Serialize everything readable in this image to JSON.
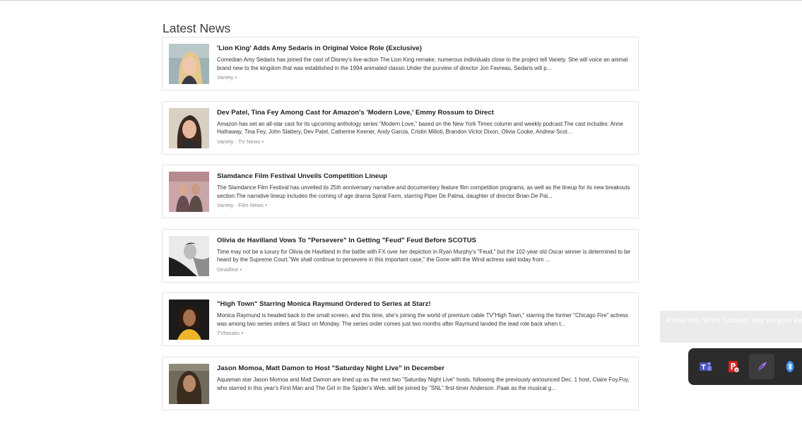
{
  "page": {
    "title": "Latest News"
  },
  "articles": [
    {
      "headline": "'Lion King' Adds Amy Sedaris in Original Voice Role (Exclusive)",
      "summary": "Comedian Amy Sedaris has joined the cast of Disney's live-action The Lion King remake, numerous individuals close to the project tell Variety. She will voice an animal brand new to the kingdom that was established in the 1994 animated classic.Under the purview of director Jon Favreau, Sedaris will p...",
      "source": "Variety •"
    },
    {
      "headline": "Dev Patel, Tina Fey Among Cast for Amazon's 'Modern Love,' Emmy Rossum to Direct",
      "summary": "Amazon has set an all-star cast for its upcoming anthology series “Modern Love,” based on the New York Times column and weekly podcast.The cast includes: Anne Hathaway, Tina Fey, John Slattery, Dev Patel, Catherine Keener, Andy Garcia, Cristin Milioti, Brandon Victor Dixon, Olivia Cooke, Andrew Scot...",
      "source": "Variety · TV News •"
    },
    {
      "headline": "Slamdance Film Festival Unveils Competition Lineup",
      "summary": "The Slamdance Film Festival has unveiled its 25th anniversary narrative and documentary feature film competition programs, as well as the lineup for its new breakouts section.The narrative lineup includes the coming of age drama Spiral Farm, starring Piper De Palma, daughter of director Brian De Pal...",
      "source": "Variety · Film News •"
    },
    {
      "headline": "Olivia de Havilland Vows To \"Persevere\" In Getting \"Feud\" Feud Before SCOTUS",
      "summary": "Time may not be a luxury for Olivia de Havilland in the battle with FX over her depiction in Ryan Murphy's \"Feud,\" but the 102-year old Oscar winner is determined to be heard by the Supreme Court.\"We shall continue to persevere in this important case,\" the Gone with the Wind actress said today from ...",
      "source": "Deadline •"
    },
    {
      "headline": "\"High Town\" Starring Monica Raymund Ordered to Series at Starz!",
      "summary": "Monica Raymund is headed back to the small screen, and this time, she's joining the world of premium cable TV\"High Town,\" starring the former \"Chicago Fire\" actress was among two series orders at Starz on Monday. The series order comes just two months after Raymund landed the lead role back when t...",
      "source": "TVfanatic •"
    },
    {
      "headline": "Jason Momoa, Matt Damon to Host \"Saturday Night Live\" in December",
      "summary": "Aquaman star Jason Momoa and Matt Damon are lined up as the next two \"Saturday Night Live\" hosts, following the previously announced Dec. 1 host, Claire Foy.Foy, who starred in this year's First Man and The Girl in the Spider's Web, will be joined by \"SNL\" first-timer Anderson .Paak as the musical g...",
      "source": ""
    }
  ],
  "notification": {
    "text": "Press the \"Print Screen\" key on your keyboard"
  },
  "taskbar": {
    "icons": [
      "teams-icon",
      "pdf-reader-icon",
      "feather-pen-icon",
      "bluetooth-icon"
    ],
    "colors": {
      "teams": "#4b53bc",
      "pdf": "#d7201f",
      "pen": "#a46bea",
      "bluetooth": "#3b8eea"
    }
  }
}
